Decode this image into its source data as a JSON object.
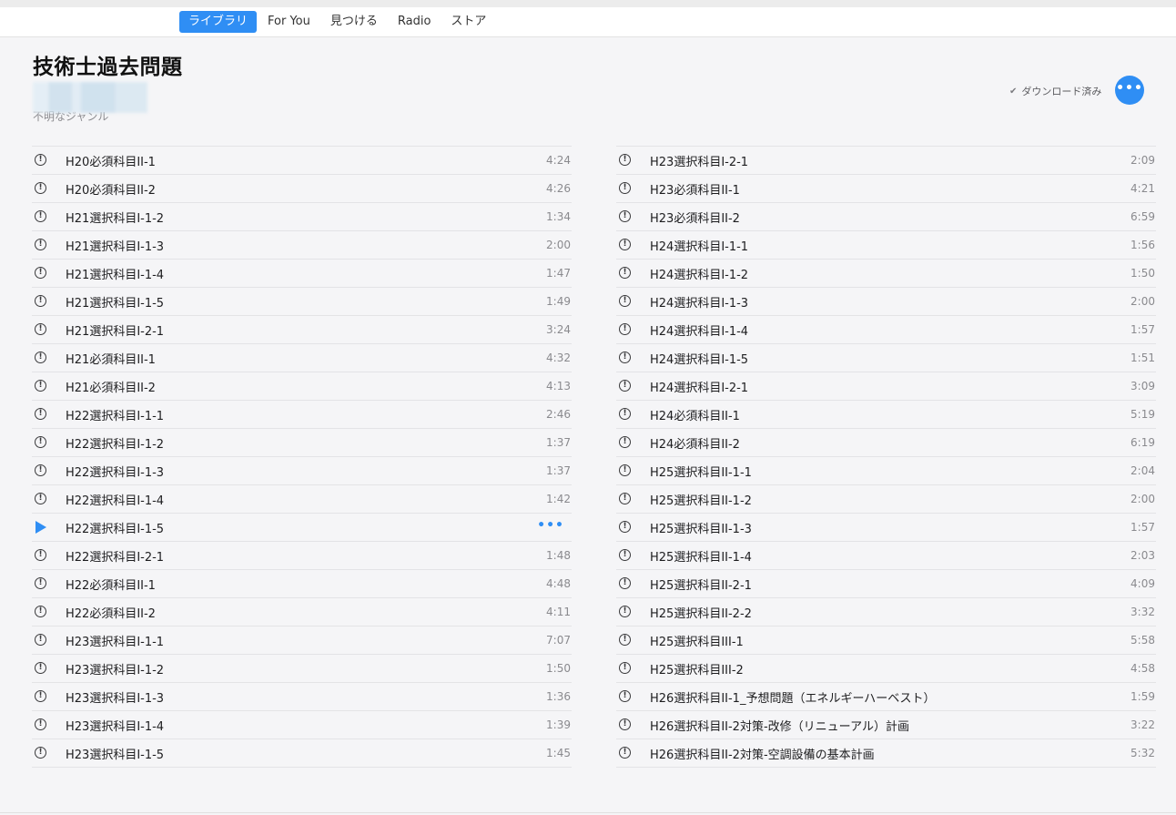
{
  "nav": {
    "tabs": [
      {
        "label": "ライブラリ",
        "active": true
      },
      {
        "label": "For You",
        "active": false
      },
      {
        "label": "見つける",
        "active": false
      },
      {
        "label": "Radio",
        "active": false
      },
      {
        "label": "ストア",
        "active": false
      }
    ]
  },
  "album": {
    "title": "技術士過去問題",
    "genre": "不明なジャンル",
    "download_status": "ダウンロード済み",
    "check_icon": "✔",
    "more_icon": "•••"
  },
  "colors": {
    "accent": "#2f8ef4"
  },
  "tracks_left": [
    {
      "name": "H20必須科目II-1",
      "duration": "4:24",
      "status": "alert"
    },
    {
      "name": "H20必須科目II-2",
      "duration": "4:26",
      "status": "alert"
    },
    {
      "name": "H21選択科目I-1-2",
      "duration": "1:34",
      "status": "alert"
    },
    {
      "name": "H21選択科目I-1-3",
      "duration": "2:00",
      "status": "alert"
    },
    {
      "name": "H21選択科目I-1-4",
      "duration": "1:47",
      "status": "alert"
    },
    {
      "name": "H21選択科目I-1-5",
      "duration": "1:49",
      "status": "alert"
    },
    {
      "name": "H21選択科目I-2-1",
      "duration": "3:24",
      "status": "alert"
    },
    {
      "name": "H21必須科目II-1",
      "duration": "4:32",
      "status": "alert"
    },
    {
      "name": "H21必須科目II-2",
      "duration": "4:13",
      "status": "alert"
    },
    {
      "name": "H22選択科目I-1-1",
      "duration": "2:46",
      "status": "alert"
    },
    {
      "name": "H22選択科目I-1-2",
      "duration": "1:37",
      "status": "alert"
    },
    {
      "name": "H22選択科目I-1-3",
      "duration": "1:37",
      "status": "alert"
    },
    {
      "name": "H22選択科目I-1-4",
      "duration": "1:42",
      "status": "alert"
    },
    {
      "name": "H22選択科目I-1-5",
      "duration": "•••",
      "status": "playing"
    },
    {
      "name": "H22選択科目I-2-1",
      "duration": "1:48",
      "status": "alert"
    },
    {
      "name": "H22必須科目II-1",
      "duration": "4:48",
      "status": "alert"
    },
    {
      "name": "H22必須科目II-2",
      "duration": "4:11",
      "status": "alert"
    },
    {
      "name": "H23選択科目I-1-1",
      "duration": "7:07",
      "status": "alert"
    },
    {
      "name": "H23選択科目I-1-2",
      "duration": "1:50",
      "status": "alert"
    },
    {
      "name": "H23選択科目I-1-3",
      "duration": "1:36",
      "status": "alert"
    },
    {
      "name": "H23選択科目I-1-4",
      "duration": "1:39",
      "status": "alert"
    },
    {
      "name": "H23選択科目I-1-5",
      "duration": "1:45",
      "status": "alert"
    }
  ],
  "tracks_right": [
    {
      "name": "H23選択科目I-2-1",
      "duration": "2:09",
      "status": "alert"
    },
    {
      "name": "H23必須科目II-1",
      "duration": "4:21",
      "status": "alert"
    },
    {
      "name": "H23必須科目II-2",
      "duration": "6:59",
      "status": "alert"
    },
    {
      "name": "H24選択科目I-1-1",
      "duration": "1:56",
      "status": "alert"
    },
    {
      "name": "H24選択科目I-1-2",
      "duration": "1:50",
      "status": "alert"
    },
    {
      "name": "H24選択科目I-1-3",
      "duration": "2:00",
      "status": "alert"
    },
    {
      "name": "H24選択科目I-1-4",
      "duration": "1:57",
      "status": "alert"
    },
    {
      "name": "H24選択科目I-1-5",
      "duration": "1:51",
      "status": "alert"
    },
    {
      "name": "H24選択科目I-2-1",
      "duration": "3:09",
      "status": "alert"
    },
    {
      "name": "H24必須科目II-1",
      "duration": "5:19",
      "status": "alert"
    },
    {
      "name": "H24必須科目II-2",
      "duration": "6:19",
      "status": "alert"
    },
    {
      "name": "H25選択科目II-1-1",
      "duration": "2:04",
      "status": "alert"
    },
    {
      "name": "H25選択科目II-1-2",
      "duration": "2:00",
      "status": "alert"
    },
    {
      "name": "H25選択科目II-1-3",
      "duration": "1:57",
      "status": "alert"
    },
    {
      "name": "H25選択科目II-1-4",
      "duration": "2:03",
      "status": "alert"
    },
    {
      "name": "H25選択科目II-2-1",
      "duration": "4:09",
      "status": "alert"
    },
    {
      "name": "H25選択科目II-2-2",
      "duration": "3:32",
      "status": "alert"
    },
    {
      "name": "H25選択科目III-1",
      "duration": "5:58",
      "status": "alert"
    },
    {
      "name": "H25選択科目III-2",
      "duration": "4:58",
      "status": "alert"
    },
    {
      "name": "H26選択科目II-1_予想問題（エネルギーハーベスト）",
      "duration": "1:59",
      "status": "alert"
    },
    {
      "name": "H26選択科目II-2対策-改修（リニューアル）計画",
      "duration": "3:22",
      "status": "alert"
    },
    {
      "name": "H26選択科目II-2対策-空調設備の基本計画",
      "duration": "5:32",
      "status": "alert"
    }
  ]
}
